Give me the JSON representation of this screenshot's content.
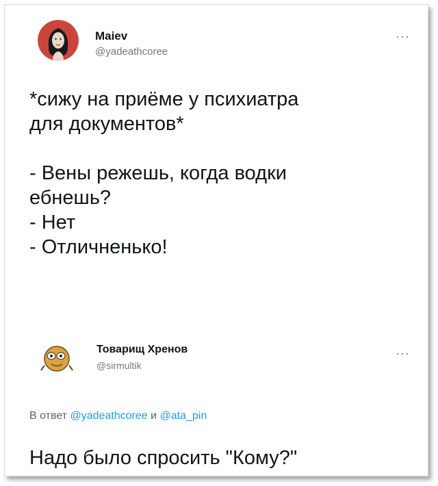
{
  "tweet": {
    "author_name": "Maiev",
    "author_handle": "@yadeathcoree",
    "more_label": "···",
    "text_lines": [
      "*сижу на приёме у психиатра",
      "для документов*",
      "",
      "- Вены режешь, когда водки",
      "ебнешь?",
      "- Нет",
      "- Отличненько!"
    ]
  },
  "reply": {
    "author_name": "Товарищ Хренов",
    "author_handle": "@sirmultik",
    "more_label": "···",
    "reply_prefix": "В ответ",
    "mention_1": "@yadeathcoree",
    "conjunction": "и",
    "mention_2": "@ata_pin",
    "text": "Надо было спросить \"Кому?\""
  },
  "colors": {
    "text": "#0f1419",
    "secondary": "#6e7781",
    "mention": "#1d9bf0"
  }
}
